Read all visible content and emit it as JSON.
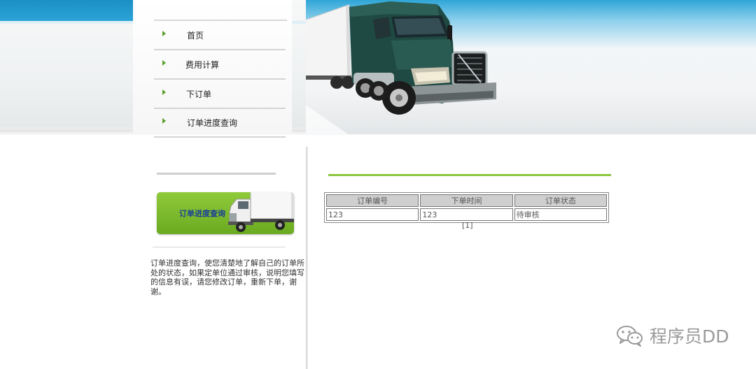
{
  "nav": {
    "items": [
      {
        "label": "首页"
      },
      {
        "label": "费用计算"
      },
      {
        "label": "下订单"
      },
      {
        "label": "订单进度查询"
      }
    ]
  },
  "sidebar": {
    "promo_label": "订单进度查询",
    "description": "订单进度查询，使您清楚地了解自己的订单所处的状态，如果定单位通过审核，说明您填写的信息有误，请您修改订单，重新下单，谢谢。"
  },
  "orders_table": {
    "headers": [
      "订单编号",
      "下单时间",
      "订单状态"
    ],
    "rows": [
      [
        "123",
        "123",
        "待审核"
      ]
    ]
  },
  "pager": {
    "text": "[1]"
  },
  "watermark": {
    "text": "程序员DD"
  },
  "icons": {
    "nav_bullet": "green-triangle-icon",
    "watermark_logo": "wechat-icon"
  },
  "colors": {
    "accent_green": "#8cc63f",
    "header_blue": "#1f95c8",
    "promo_text": "#1a3d9a"
  }
}
